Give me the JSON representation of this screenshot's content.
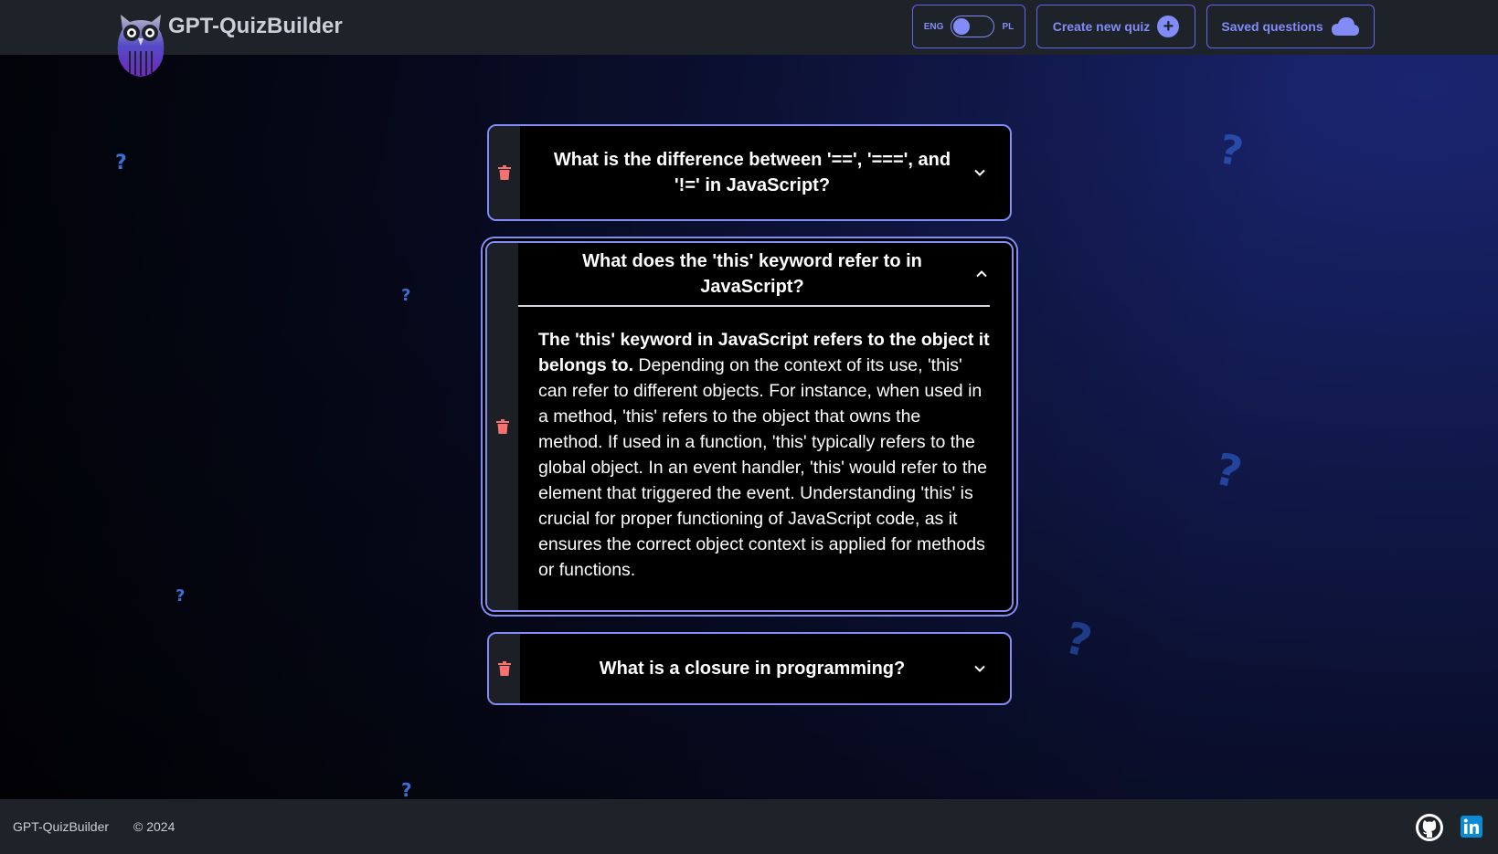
{
  "header": {
    "brand": "GPT-QuizBuilder",
    "lang": {
      "left": "ENG",
      "right": "PL"
    },
    "create_label": "Create new quiz",
    "saved_label": "Saved questions"
  },
  "cards": [
    {
      "question": "What is the difference between '==', '===', and '!=' in JavaScript?",
      "expanded": false
    },
    {
      "question": "What does the 'this' keyword refer to in JavaScript?",
      "expanded": true,
      "answer_bold": "The 'this' keyword in JavaScript refers to the object it belongs to.",
      "answer_rest": " Depending on the context of its use, 'this' can refer to different objects. For instance, when used in a method, 'this' refers to the object that owns the method. If used in a function, 'this' typically refers to the global object. In an event handler, 'this' would refer to the element that triggered the event. Understanding 'this' is crucial for proper functioning of JavaScript code, as it ensures the correct object context is applied for methods or functions."
    },
    {
      "question": "What is a closure in programming?",
      "expanded": false
    }
  ],
  "footer": {
    "brand": "GPT-QuizBuilder",
    "copyright": "© 2024"
  },
  "decor": {
    "question_mark": "?"
  },
  "colors": {
    "accent": "#818cf8",
    "card_border": "#818cf8",
    "trash": "#f87171",
    "header_bg": "#1e2229"
  },
  "icons": [
    "owl-logo-icon",
    "plus-circle-icon",
    "cloud-icon",
    "trash-icon",
    "chevron-down-icon",
    "chevron-up-icon",
    "github-icon",
    "linkedin-icon"
  ]
}
